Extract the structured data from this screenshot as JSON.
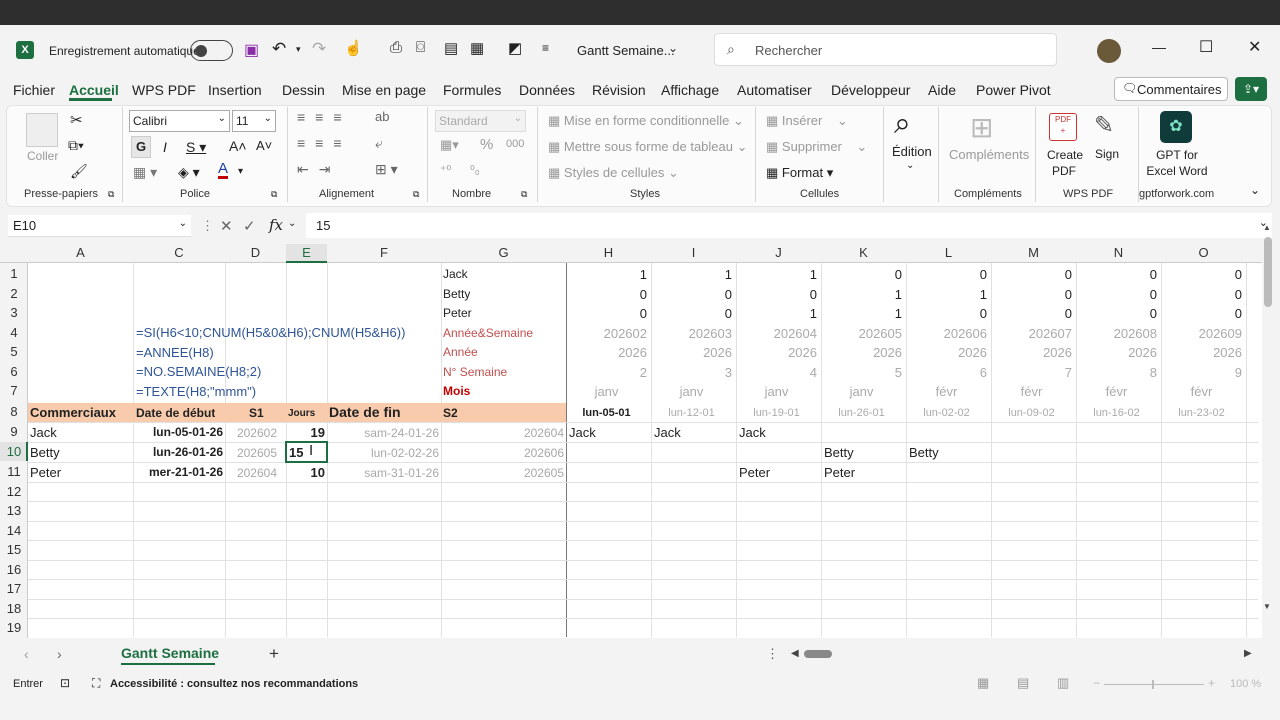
{
  "title_bar": {
    "autosave_label": "Enregistrement automatique",
    "doc_title": "Gantt Semaine...",
    "search_placeholder": "Rechercher"
  },
  "menu": [
    "Fichier",
    "Accueil",
    "WPS PDF",
    "Insertion",
    "Dessin",
    "Mise en page",
    "Formules",
    "Données",
    "Révision",
    "Affichage",
    "Automatiser",
    "Développeur",
    "Aide",
    "Power Pivot"
  ],
  "comments_label": "Commentaires",
  "ribbon": {
    "paste_label": "Coller",
    "font_name": "Calibri",
    "font_size": "11",
    "number_format": "Standard",
    "cond_format": "Mise en forme conditionnelle",
    "table_format": "Mettre sous forme de tableau",
    "cell_styles": "Styles de cellules",
    "insert": "Insérer",
    "delete": "Supprimer",
    "format": "Format",
    "edition": "Édition",
    "addins": "Compléments",
    "create_pdf": "Create PDF",
    "sign": "Sign",
    "gpt": "GPT for Excel Word",
    "groups": {
      "clipboard": "Presse-papiers",
      "font": "Police",
      "alignment": "Alignement",
      "number": "Nombre",
      "styles": "Styles",
      "cells": "Cellules",
      "addins": "Compléments",
      "wps": "WPS PDF",
      "gptsite": "gptforwork.com"
    }
  },
  "formula_bar": {
    "name_box": "E10",
    "value": "15"
  },
  "columns": [
    "A",
    "C",
    "D",
    "E",
    "F",
    "G",
    "H",
    "I",
    "J",
    "K",
    "L",
    "M",
    "N",
    "O"
  ],
  "rows": [
    "1",
    "2",
    "3",
    "4",
    "5",
    "6",
    "7",
    "8",
    "9",
    "10",
    "11",
    "12",
    "13",
    "14",
    "15",
    "16",
    "17",
    "18",
    "19"
  ],
  "formulas": {
    "r4": "=SI(H6<10;CNUM(H5&0&H6);CNUM(H5&H6))",
    "r5": "=ANNEE(H8)",
    "r6": "=NO.SEMAINE(H8;2)",
    "r7": "=TEXTE(H8;\"mmm\")"
  },
  "g_labels": [
    "Jack",
    "Betty",
    "Peter",
    "Année&Semaine",
    "Année",
    "N° Semaine",
    "Mois"
  ],
  "grid_rows": {
    "r1": [
      "1",
      "1",
      "1",
      "0",
      "0",
      "0",
      "0",
      "0"
    ],
    "r2": [
      "0",
      "0",
      "0",
      "1",
      "1",
      "0",
      "0",
      "0"
    ],
    "r3": [
      "0",
      "0",
      "1",
      "1",
      "0",
      "0",
      "0",
      "0"
    ],
    "r4": [
      "202602",
      "202603",
      "202604",
      "202605",
      "202606",
      "202607",
      "202608",
      "202609"
    ],
    "r5": [
      "2026",
      "2026",
      "2026",
      "2026",
      "2026",
      "2026",
      "2026",
      "2026"
    ],
    "r6": [
      "2",
      "3",
      "4",
      "5",
      "6",
      "7",
      "8",
      "9"
    ],
    "r7": [
      "janv",
      "janv",
      "janv",
      "janv",
      "févr",
      "févr",
      "févr",
      "févr"
    ],
    "r8": [
      "lun-05-01",
      "lun-12-01",
      "lun-19-01",
      "lun-26-01",
      "lun-02-02",
      "lun-09-02",
      "lun-16-02",
      "lun-23-02"
    ]
  },
  "header_row": {
    "a": "Commerciaux",
    "c": "Date de début",
    "d": "S1",
    "e": "Jours",
    "f": "Date de fin",
    "g": "S2"
  },
  "data_rows": [
    {
      "a": "Jack",
      "c": "lun-05-01-26",
      "d": "202602",
      "e": "19",
      "f": "sam-24-01-26",
      "g": "202604"
    },
    {
      "a": "Betty",
      "c": "lun-26-01-26",
      "d": "202605",
      "e": "15",
      "f": "lun-02-02-26",
      "g": "202606"
    },
    {
      "a": "Peter",
      "c": "mer-21-01-26",
      "d": "202604",
      "e": "10",
      "f": "sam-31-01-26",
      "g": "202605"
    }
  ],
  "gantt": {
    "r9": [
      "Jack",
      "Jack",
      "Jack",
      "",
      "",
      "",
      "",
      ""
    ],
    "r10": [
      "",
      "",
      "",
      "Betty",
      "Betty",
      "",
      "",
      ""
    ],
    "r11": [
      "",
      "",
      "Peter",
      "Peter",
      "",
      "",
      "",
      ""
    ]
  },
  "sheet_tab": "Gantt Semaine",
  "status": {
    "mode": "Entrer",
    "accessibility": "Accessibilité : consultez nos recommandations",
    "zoom": "100 %"
  }
}
